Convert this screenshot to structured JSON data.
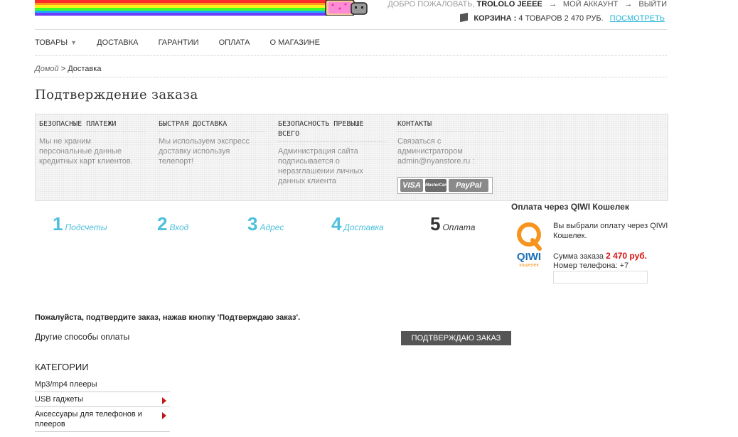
{
  "header": {
    "welcome": "ДОБРО ПОЖАЛОВАТЬ,",
    "user": "TROLOLO JEEEE",
    "account": "МОЙ АККАУНТ",
    "logout": "ВЫЙТИ",
    "cart_label": "КОРЗИНА :",
    "cart_summary": "4 ТОВАРОВ 2 470 РУБ.",
    "cart_view": "ПОСМОТРЕТЬ"
  },
  "nav": {
    "items": [
      "ТОВАРЫ",
      "ДОСТАВКА",
      "ГАРАНТИИ",
      "ОПЛАТА",
      "О МАГАЗИНЕ"
    ]
  },
  "breadcrumb": {
    "home": "Домой",
    "sep": ">",
    "current": "Доставка"
  },
  "page_title": "Подтверждение заказа",
  "info": [
    {
      "title": "БЕЗОПАСНЫЕ ПЛАТЕЖИ",
      "text": "Мы не храним персональные данные кредитных карт клиентов."
    },
    {
      "title": "БЫСТРАЯ ДОСТАВКА",
      "text": "Мы используем экспресс доставку используя телепорт!"
    },
    {
      "title": "БЕЗОПАСНОСТЬ ПРЕВЫШЕ ВСЕГО",
      "text": "Администрация сайта подписывается о неразглашении личных данных клиента"
    },
    {
      "title": "КОНТАКТЫ",
      "text": "Связаться с администратором admin@nyanstore.ru :"
    }
  ],
  "cards": [
    "VISA",
    "MasterCard",
    "PayPal"
  ],
  "steps": [
    {
      "num": "1",
      "label": "Подсчеты"
    },
    {
      "num": "2",
      "label": "Вход"
    },
    {
      "num": "3",
      "label": "Адрес"
    },
    {
      "num": "4",
      "label": "Доставка"
    },
    {
      "num": "5",
      "label": "Оплата"
    }
  ],
  "qiwi": {
    "title": "Оплата через QIWI Кошелек",
    "logo_word": "QIWI",
    "logo_sub": "кошелек",
    "text": "Вы выбрали оплату через QIWI Кошелек.",
    "sum_label": "Сумма заказа",
    "sum_value": "2 470 руб.",
    "phone_label": "Номер телефона: +7",
    "phone_value": ""
  },
  "confirm_text": "Пожалуйста, подтвердите заказ, нажав кнопку 'Подтверждаю заказ'.",
  "other_methods": "Другие способы оплаты",
  "confirm_button": "ПОДТВЕРЖДАЮ ЗАКАЗ",
  "categories": {
    "title": "КАТЕГОРИИ",
    "items": [
      "Mp3/mp4 плееры",
      "USB гаджеты",
      "Аксессуары для телефонов и плееров"
    ]
  },
  "colors": {
    "accent": "#4ec0dd",
    "price": "#d91111",
    "button": "#555555"
  }
}
